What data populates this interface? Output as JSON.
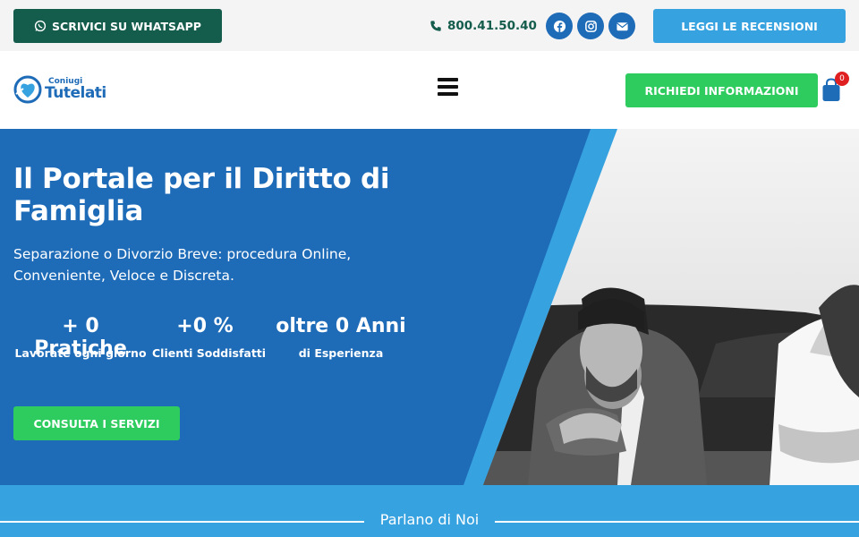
{
  "topbar": {
    "whatsapp_label": "SCRIVICI SU WHATSAPP",
    "phone": "800.41.50.40",
    "social": [
      "facebook-icon",
      "instagram-icon",
      "envelope-icon"
    ],
    "reviews_label": "LEGGI LE RECENSIONI"
  },
  "header": {
    "logo_small": "Coniugi",
    "logo_big": "Tutelati",
    "info_label": "RICHIEDI INFORMAZIONI",
    "cart_count": "0"
  },
  "hero": {
    "title": "Il Portale per il Diritto di Famiglia",
    "subtitle": "Separazione o Divorzio Breve: procedura Online, Conveniente, Veloce e Discreta.",
    "stats": [
      {
        "number": "+ 0 Pratiche",
        "label": "Lavorate ogni giorno"
      },
      {
        "number": "+0 %",
        "label": "Clienti Soddisfatti"
      },
      {
        "number": "oltre 0 Anni",
        "label": "di Esperienza"
      }
    ],
    "cta_label": "CONSULTA I SERVIZI"
  },
  "band": {
    "title": "Parlano di Noi"
  },
  "colors": {
    "dark_green": "#145c4c",
    "brand_blue": "#1e6bb8",
    "light_blue": "#37a2e0",
    "green": "#2ecc5e"
  }
}
